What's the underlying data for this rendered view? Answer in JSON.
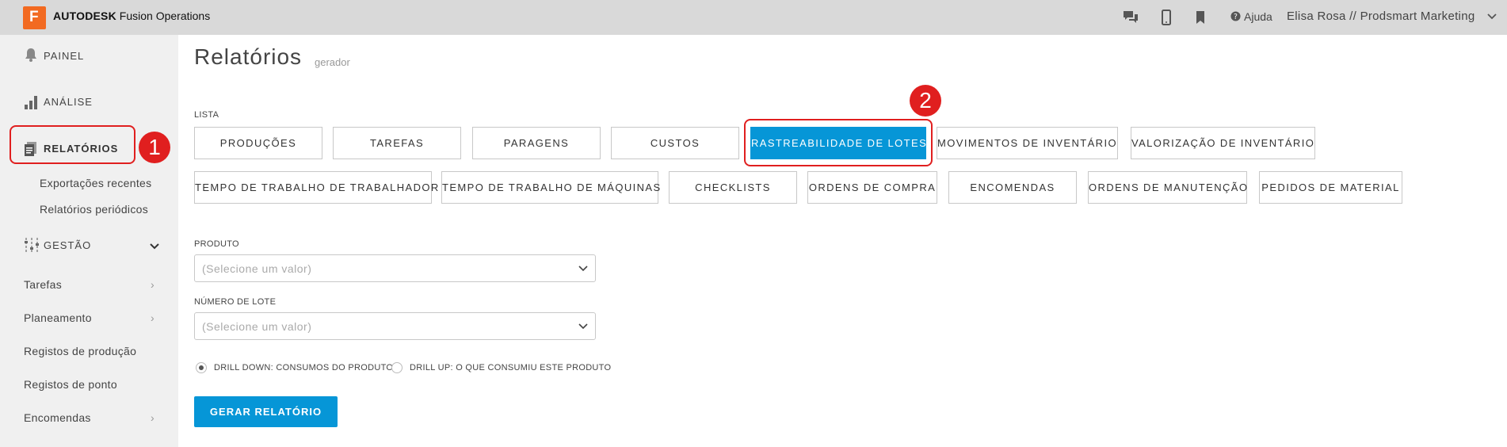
{
  "app": {
    "logo_letter": "F",
    "brand_bold": "AUTODESK",
    "brand_rest": "Fusion Operations",
    "help_label": "Ajuda",
    "user_label": "Elisa Rosa // Prodsmart Marketing",
    "icons": [
      "chat-icon",
      "mobile-icon",
      "bookmark-icon",
      "help-icon",
      "chevron-down-icon"
    ]
  },
  "sidebar": {
    "painel": "PAINEL",
    "analise": "ANÁLISE",
    "relatorios": "RELATÓRIOS",
    "exportacoes": "Exportações recentes",
    "periodicos": "Relatórios periódicos",
    "gestao": "GESTÃO",
    "sub_items": [
      {
        "label": "Tarefas",
        "has_children": true
      },
      {
        "label": "Planeamento",
        "has_children": true
      },
      {
        "label": "Registos de produção",
        "has_children": false
      },
      {
        "label": "Registos de ponto",
        "has_children": false
      },
      {
        "label": "Encomendas",
        "has_children": true
      }
    ]
  },
  "annotations": {
    "one": "1",
    "two": "2"
  },
  "main": {
    "title": "Relatórios",
    "subtitle": "gerador",
    "list_label": "LISTA",
    "tiles_row1": [
      "PRODUÇÕES",
      "TAREFAS",
      "PARAGENS",
      "CUSTOS",
      "RASTREABILIDADE DE LOTES",
      "MOVIMENTOS DE INVENTÁRIO",
      "VALORIZAÇÃO DE INVENTÁRIO"
    ],
    "tiles_row2": [
      "TEMPO DE TRABALHO DE TRABALHADOR",
      "TEMPO DE TRABALHO DE MÁQUINAS",
      "CHECKLISTS",
      "ORDENS DE COMPRA",
      "ENCOMENDAS",
      "ORDENS DE MANUTENÇÃO",
      "PEDIDOS DE MATERIAL"
    ],
    "active_tile": "RASTREABILIDADE DE LOTES",
    "produto_label": "PRODUTO",
    "produto_placeholder": "(Selecione um valor)",
    "lote_label": "NÚMERO DE LOTE",
    "lote_placeholder": "(Selecione um valor)",
    "radio_down": "DRILL DOWN: CONSUMOS DO PRODUTO",
    "radio_up": "DRILL UP: O QUE CONSUMIU ESTE PRODUTO",
    "generate": "GERAR RELATÓRIO"
  },
  "colors": {
    "accent": "#0696d7",
    "brand": "#f26a21",
    "annotation": "#e01f1f"
  }
}
